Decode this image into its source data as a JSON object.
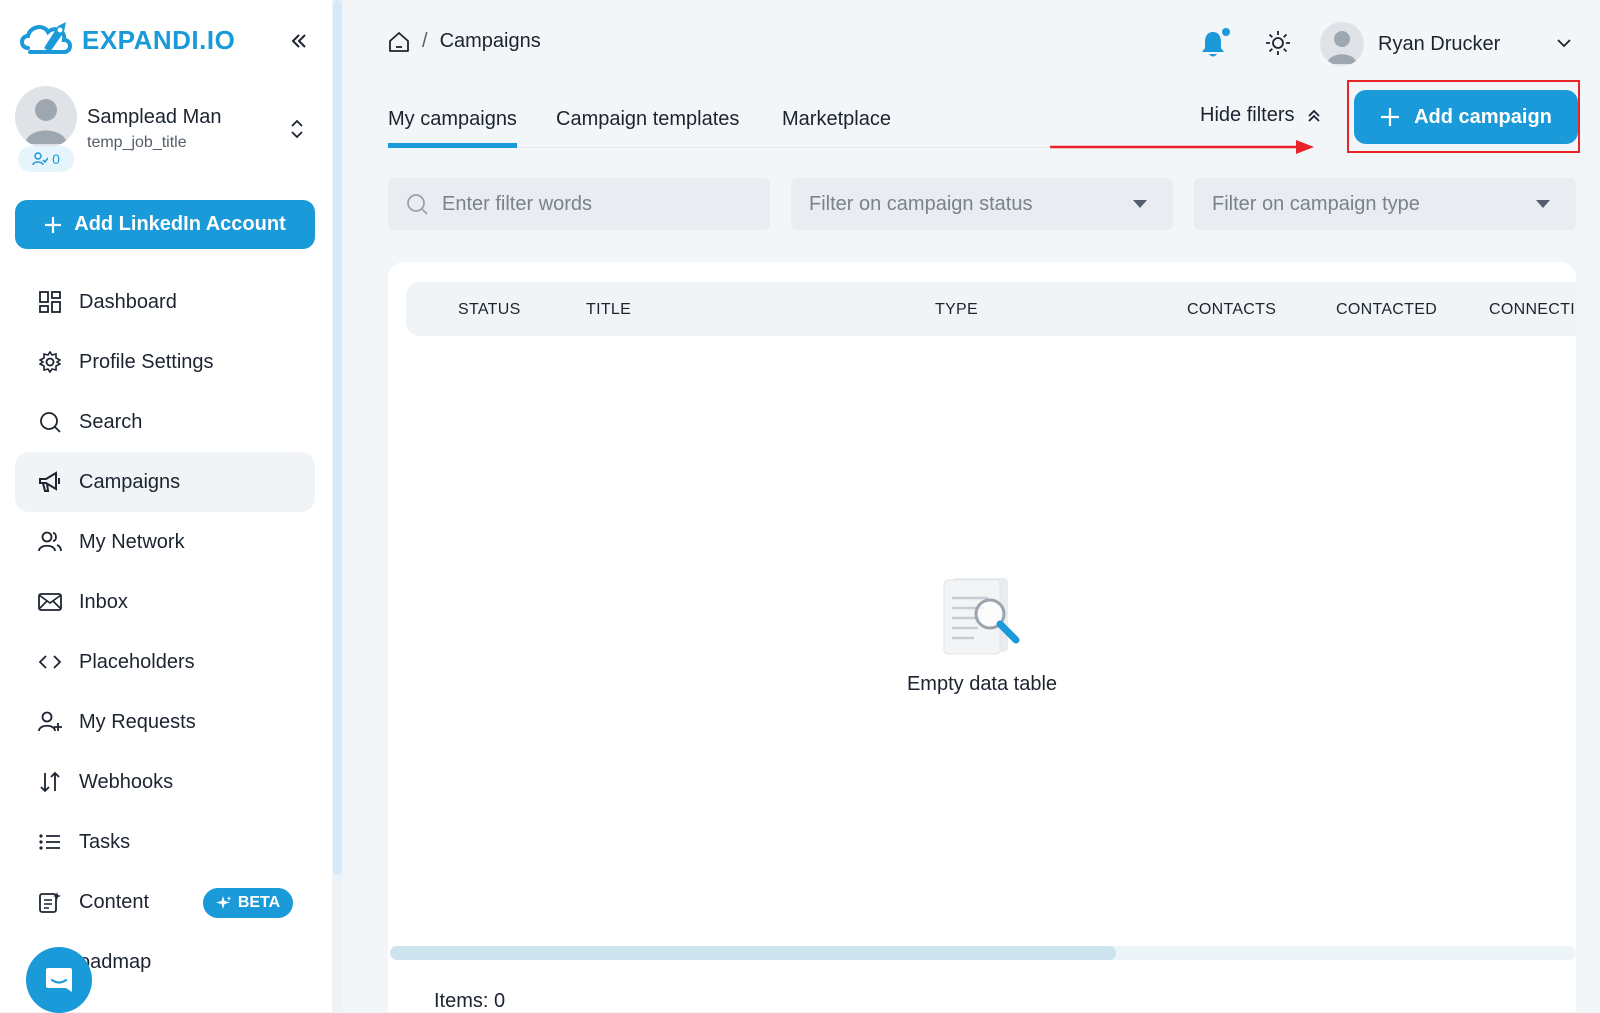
{
  "brand": {
    "logo_text": "EXPANDI.IO"
  },
  "profile": {
    "name": "Samplead Man",
    "job_title": "temp_job_title",
    "connections_count": "0"
  },
  "sidebar": {
    "add_account_label": "Add LinkedIn Account",
    "items": [
      {
        "label": "Dashboard",
        "icon": "dashboard-icon"
      },
      {
        "label": "Profile Settings",
        "icon": "gear-icon"
      },
      {
        "label": "Search",
        "icon": "search-icon"
      },
      {
        "label": "Campaigns",
        "icon": "megaphone-icon",
        "active": true
      },
      {
        "label": "My Network",
        "icon": "users-icon"
      },
      {
        "label": "Inbox",
        "icon": "mail-icon"
      },
      {
        "label": "Placeholders",
        "icon": "code-icon"
      },
      {
        "label": "My Requests",
        "icon": "user-plus-icon"
      },
      {
        "label": "Webhooks",
        "icon": "arrows-updown-icon"
      },
      {
        "label": "Tasks",
        "icon": "list-icon"
      },
      {
        "label": "Content",
        "icon": "content-icon",
        "badge": "BETA"
      },
      {
        "label": "oadmap",
        "icon": "roadmap-icon"
      }
    ]
  },
  "header": {
    "breadcrumb": {
      "separator": "/",
      "current": "Campaigns"
    },
    "user_name": "Ryan Drucker"
  },
  "tabs": [
    {
      "label": "My campaigns",
      "active": true
    },
    {
      "label": "Campaign templates"
    },
    {
      "label": "Marketplace"
    }
  ],
  "actions": {
    "hide_filters_label": "Hide filters",
    "add_campaign_label": "Add campaign"
  },
  "filters": {
    "search_placeholder": "Enter filter words",
    "status_placeholder": "Filter on campaign status",
    "type_placeholder": "Filter on campaign type"
  },
  "table": {
    "columns": [
      "STATUS",
      "TITLE",
      "TYPE",
      "CONTACTS",
      "CONTACTED",
      "CONNECTI"
    ],
    "empty_text": "Empty data table",
    "items_label": "Items: 0"
  },
  "colors": {
    "accent": "#1a9ad9",
    "annotation": "#e8232a"
  }
}
